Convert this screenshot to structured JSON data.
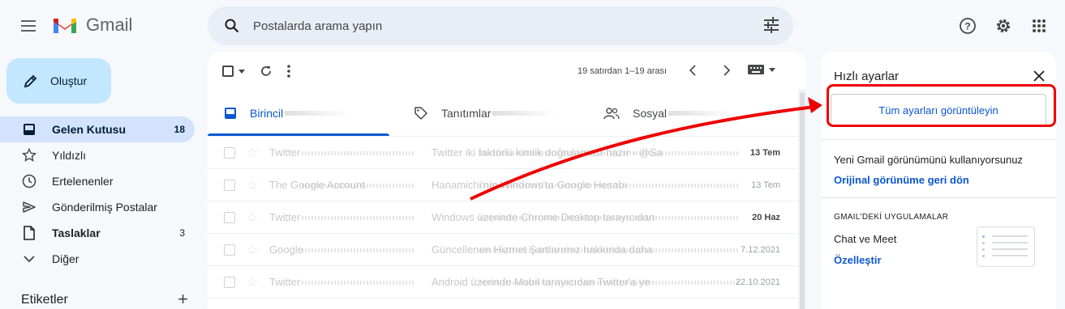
{
  "app": {
    "name": "Gmail"
  },
  "search": {
    "placeholder": "Postalarda arama yapın"
  },
  "compose": {
    "label": "Oluştur"
  },
  "sidebar": {
    "items": [
      {
        "label": "Gelen Kutusu",
        "count": "18",
        "icon": "inbox-icon"
      },
      {
        "label": "Yıldızlı",
        "count": "",
        "icon": "star-icon"
      },
      {
        "label": "Ertelenenler",
        "count": "",
        "icon": "clock-icon"
      },
      {
        "label": "Gönderilmiş Postalar",
        "count": "",
        "icon": "send-icon"
      },
      {
        "label": "Taslaklar",
        "count": "3",
        "icon": "draft-icon"
      },
      {
        "label": "Diğer",
        "count": "",
        "icon": "chevron-down-icon"
      }
    ],
    "labels_heading": "Etiketler",
    "labels_add": "+"
  },
  "toolbar": {
    "range": "19 satırdan 1–19 arası"
  },
  "tabs": [
    {
      "label": "Birincil",
      "icon": "inbox-icon"
    },
    {
      "label": "Tanıtımlar",
      "icon": "tag-icon"
    },
    {
      "label": "Sosyal",
      "icon": "people-icon"
    }
  ],
  "emails": [
    {
      "sender": "Twitter",
      "subject": "Twitter iki faktörlü kimlik doğrulaması hazır - @Sa",
      "date": "13 Tem",
      "unread": true
    },
    {
      "sender": "The Google Account",
      "subject": "Hanamichi'nin Windows'ta Google Hesabı",
      "date": "13 Tem",
      "unread": false
    },
    {
      "sender": "Twitter",
      "subject": "Windows üzerinde Chrome Desktop tarayıcıdan",
      "date": "20 Haz",
      "unread": true
    },
    {
      "sender": "Google",
      "subject": "Güncellenen Hizmet Şartlarımız hakkında daha",
      "date": "7.12.2021",
      "unread": false
    },
    {
      "sender": "Twitter",
      "subject": "Android üzerinde Mobil tarayıcıdan Twitter'a ye",
      "date": "22.10.2021",
      "unread": false
    }
  ],
  "quick_settings": {
    "title": "Hızlı ayarlar",
    "all_settings_button": "Tüm ayarları görüntüleyin",
    "new_view_text": "Yeni Gmail görünümünü kullanıyorsunuz",
    "revert_link": "Orijinal görünüme geri dön",
    "apps_heading": "GMAIL'DEKİ UYGULAMALAR",
    "chat_meet": "Chat ve Meet",
    "customize_link": "Özelleştir"
  },
  "colors": {
    "accent": "#0b57d0",
    "highlight": "#e00000",
    "compose_bg": "#c2e7ff",
    "active_nav": "#d3e3fd"
  }
}
